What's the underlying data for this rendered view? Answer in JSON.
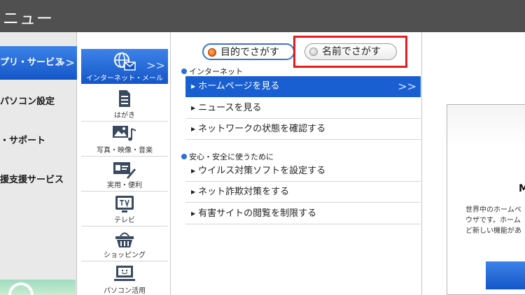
{
  "titlebar": {
    "title": "ニュー"
  },
  "left_categories": [
    {
      "label": "プリ・サービス",
      "active": true
    },
    {
      "label": "パソコン設定",
      "active": false
    },
    {
      "label": "・サポート",
      "active": false
    },
    {
      "label": "援支援サービス",
      "active": false
    }
  ],
  "icon_menu": [
    {
      "label": "インターネット・メール",
      "icon": "globe-mail-icon",
      "active": true
    },
    {
      "label": "はがき",
      "icon": "postcard-icon",
      "active": false
    },
    {
      "label": "写真・映像・音楽",
      "icon": "photo-music-icon",
      "active": false
    },
    {
      "label": "実用・便利",
      "icon": "card-pen-icon",
      "active": false
    },
    {
      "label": "テレビ",
      "icon": "tv-icon",
      "active": false
    },
    {
      "label": "ショッピング",
      "icon": "shopping-basket-icon",
      "active": false
    },
    {
      "label": "パソコン活用",
      "icon": "pc-user-icon",
      "active": false
    }
  ],
  "search_mode": {
    "purpose": "目的でさがす",
    "name": "名前でさがす",
    "selected": "purpose"
  },
  "sections": [
    {
      "title": "インターネット",
      "items": [
        {
          "label": "ホームページを見る",
          "active": true
        },
        {
          "label": "ニュースを見る",
          "active": false
        },
        {
          "label": "ネットワークの状態を確認する",
          "active": false
        }
      ]
    },
    {
      "title": "安心・安全に使うために",
      "items": [
        {
          "label": "ウイルス対策ソフトを設定する",
          "active": false
        },
        {
          "label": "ネット詐欺対策をする",
          "active": false
        },
        {
          "label": "有害サイトの閲覧を制限する",
          "active": false
        }
      ]
    }
  ],
  "preview": {
    "heading": "M",
    "description": [
      "世界中のホームペ",
      "ウザです。ホーム",
      "ど新しい機能があ"
    ]
  },
  "colors": {
    "accent": "#1a5fd2",
    "highlight": "#e81c1c",
    "titlebar": "#505050"
  }
}
